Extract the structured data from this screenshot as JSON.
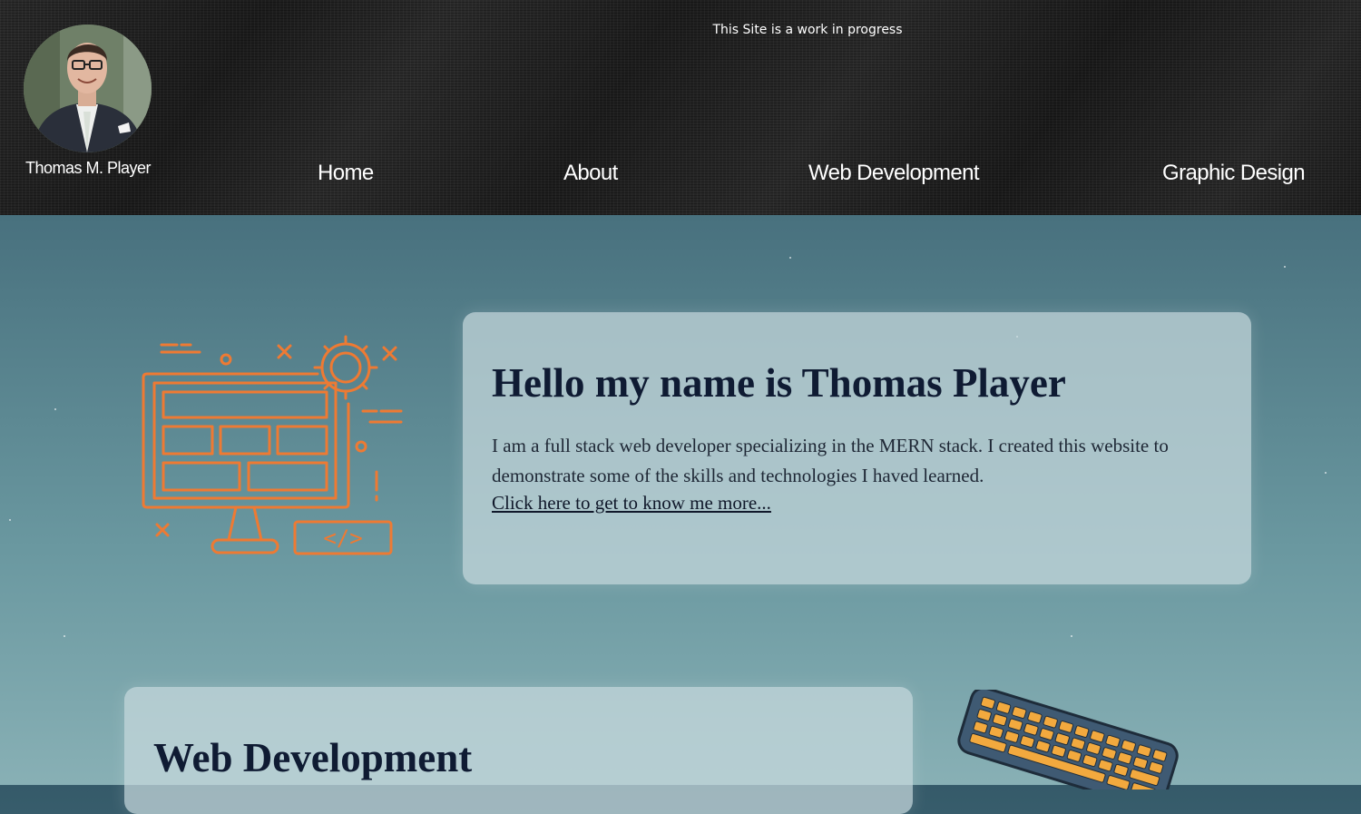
{
  "header": {
    "banner": "This Site is a work in progress",
    "owner_name": "Thomas M. Player",
    "nav": [
      {
        "label": "Home"
      },
      {
        "label": "About"
      },
      {
        "label": "Web Development"
      },
      {
        "label": "Graphic Design"
      }
    ]
  },
  "intro": {
    "title": "Hello my name is Thomas Player",
    "text": "I am a full stack web developer specializing in the MERN stack. I created this website to demonstrate some of the skills and technologies I haved learned.",
    "link": "Click here to get to know me more..."
  },
  "web_dev": {
    "title": "Web Development"
  },
  "icons": {
    "avatar": "profile-photo",
    "hero": "web-development-monitor-icon",
    "hero_code_label": "</>",
    "section_image": "keyboard-illustration"
  },
  "colors": {
    "accent_orange": "#ee7a33",
    "title_navy": "#0f1b33",
    "header_bg": "#1e1e1e"
  }
}
